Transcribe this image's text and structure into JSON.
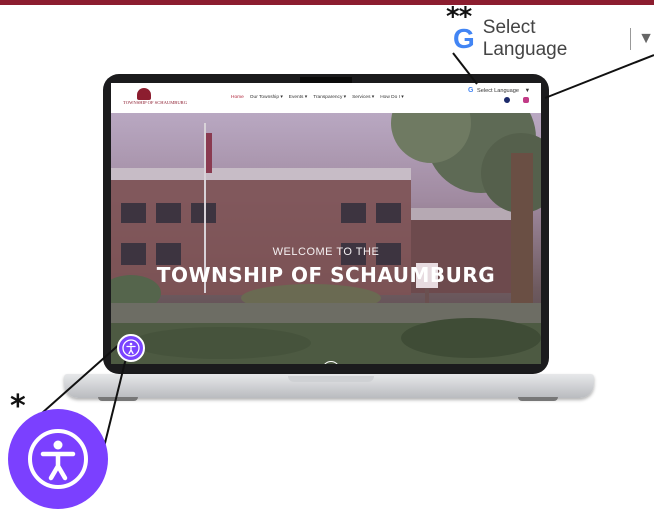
{
  "annotations": {
    "star_single": "*",
    "star_double": "**"
  },
  "language_widget": {
    "g_letter": "G",
    "label": "Select Language",
    "arrow": "▼"
  },
  "site": {
    "logo_text": "TOWNSHIP OF SCHAUMBURG",
    "nav": [
      "Home",
      "Our Township ▾",
      "Events ▾",
      "Transparency ▾",
      "Services ▾",
      "How Do I ▾"
    ],
    "language_label": "Select Language",
    "language_arrow": "▼",
    "hero": {
      "welcome": "WELCOME TO THE",
      "title": "TOWNSHIP OF SCHAUMBURG",
      "scroll_glyph": "↓"
    }
  },
  "colors": {
    "brand_maroon": "#8c1d2f",
    "accessibility_purple": "#7b40ff",
    "google_blue": "#4285F4",
    "google_red": "#EA4335"
  },
  "icons": {
    "accessibility": "accessibility-person-icon",
    "facebook": "facebook-icon",
    "instagram": "instagram-icon",
    "google": "google-g-icon"
  }
}
